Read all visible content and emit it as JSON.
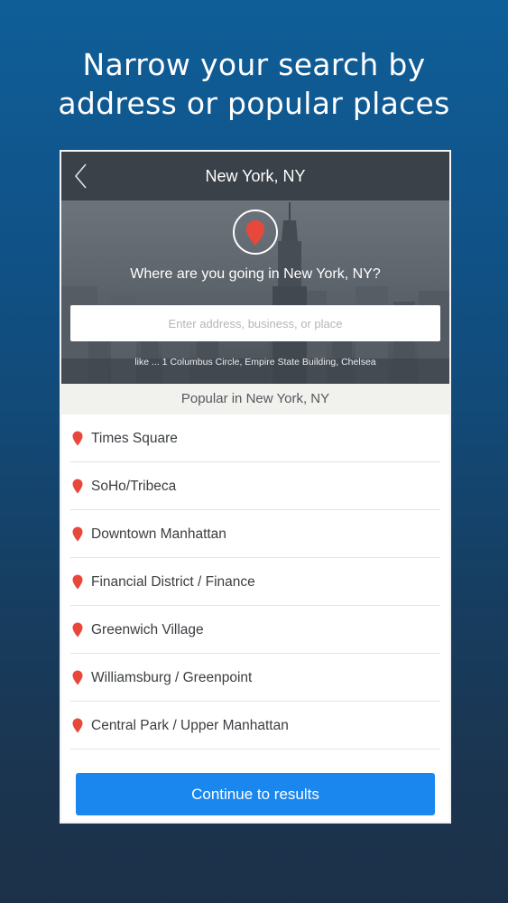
{
  "headline": {
    "line1": "Narrow your search by",
    "line2": "address or popular places"
  },
  "navbar": {
    "title": "New York, NY",
    "back_icon": "chevron-left-icon"
  },
  "hero": {
    "pin_icon": "map-pin-icon",
    "question": "Where are you going in New York, NY?",
    "search": {
      "placeholder": "Enter address, business, or place",
      "value": ""
    },
    "hint": "like ... 1 Columbus Circle, Empire State Building, Chelsea"
  },
  "popular": {
    "header": "Popular in New York, NY",
    "items": [
      {
        "label": "Times Square"
      },
      {
        "label": "SoHo/Tribeca"
      },
      {
        "label": "Downtown Manhattan"
      },
      {
        "label": "Financial District / Finance"
      },
      {
        "label": "Greenwich Village"
      },
      {
        "label": "Williamsburg / Greenpoint"
      },
      {
        "label": "Central Park / Upper Manhattan"
      }
    ]
  },
  "cta": {
    "label": "Continue to results"
  },
  "colors": {
    "accent_blue": "#1a87ef",
    "pin_red": "#e8483b",
    "navbar": "#3a4149"
  }
}
